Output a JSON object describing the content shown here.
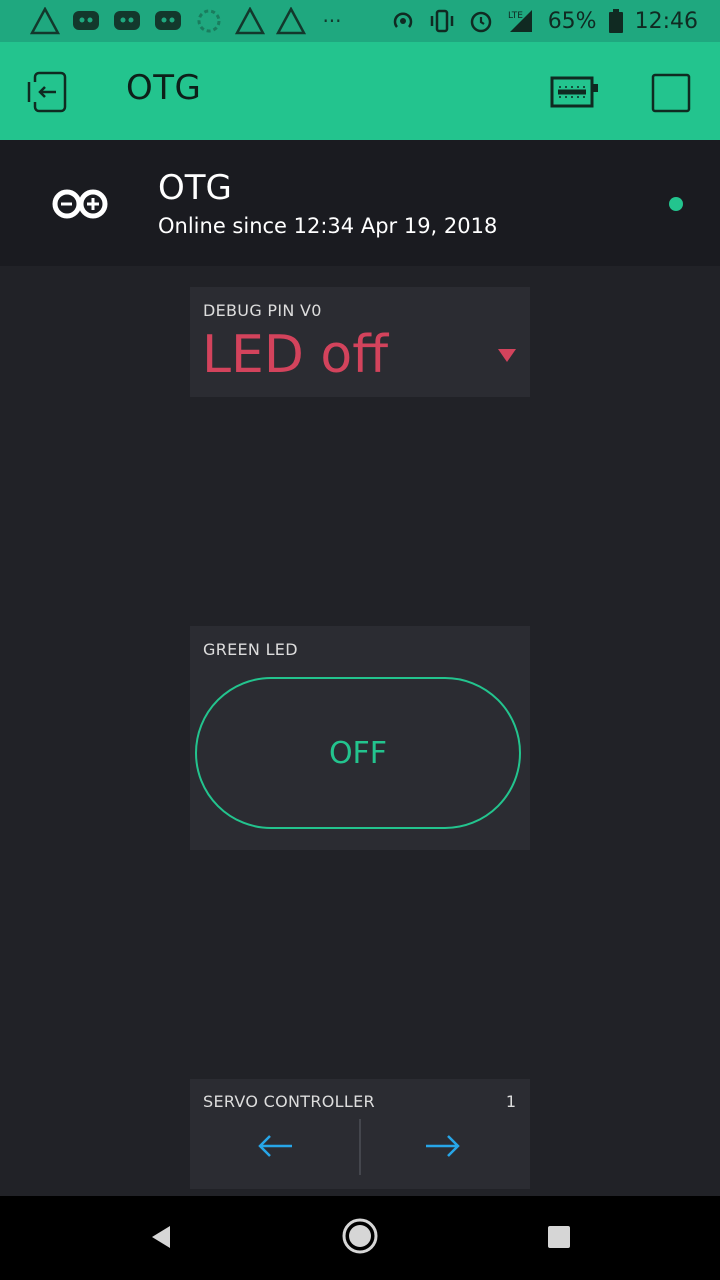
{
  "status_bar": {
    "battery_percent": "65%",
    "time": "12:46",
    "network": "LTE",
    "more_label": "···"
  },
  "toolbar": {
    "title": "OTG"
  },
  "device": {
    "name": "OTG",
    "status": "Online since 12:34 Apr 19, 2018",
    "online_color": "#23c48e"
  },
  "widgets": {
    "menu": {
      "label": "DEBUG PIN V0",
      "value": "LED off"
    },
    "button": {
      "label": "GREEN LED",
      "state": "OFF"
    },
    "servo": {
      "label": "SERVO CONTROLLER",
      "value": "1"
    }
  },
  "colors": {
    "accent": "#23c48e",
    "menu_value": "#d3435c",
    "arrow": "#27a6e8"
  }
}
